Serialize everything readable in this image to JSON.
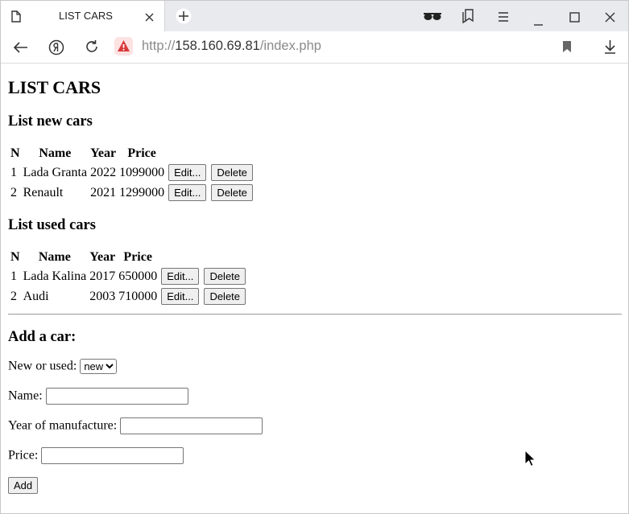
{
  "browser": {
    "tab_title": "LIST CARS",
    "url_protocol": "http://",
    "url_host": "158.160.69.81",
    "url_path": "/index.php",
    "icons": [
      "document-icon",
      "close-icon",
      "new-tab-icon",
      "reading-glasses-icon",
      "bookmarks-icon",
      "menu-icon",
      "minimize-icon",
      "maximize-icon",
      "close-window-icon",
      "back-icon",
      "yandex-icon",
      "reload-icon",
      "warning-icon",
      "bookmark-icon",
      "download-icon"
    ]
  },
  "page": {
    "title": "LIST CARS",
    "new_cars": {
      "heading": "List new cars",
      "columns": [
        "N",
        "Name",
        "Year",
        "Price"
      ],
      "rows": [
        {
          "n": "1",
          "name": "Lada Granta",
          "year": "2022",
          "price": "1099000"
        },
        {
          "n": "2",
          "name": "Renault",
          "year": "2021",
          "price": "1299000"
        }
      ]
    },
    "used_cars": {
      "heading": "List used cars",
      "columns": [
        "N",
        "Name",
        "Year",
        "Price"
      ],
      "rows": [
        {
          "n": "1",
          "name": "Lada Kalina",
          "year": "2017",
          "price": "650000"
        },
        {
          "n": "2",
          "name": "Audi",
          "year": "2003",
          "price": "710000"
        }
      ]
    },
    "edit_label": "Edit...",
    "delete_label": "Delete",
    "add_form": {
      "heading": "Add a car:",
      "type_label": "New or used:",
      "type_selected": "new",
      "name_label": "Name:",
      "year_label": "Year of manufacture:",
      "price_label": "Price:",
      "name_value": "",
      "year_value": "",
      "price_value": "",
      "add_label": "Add"
    }
  }
}
